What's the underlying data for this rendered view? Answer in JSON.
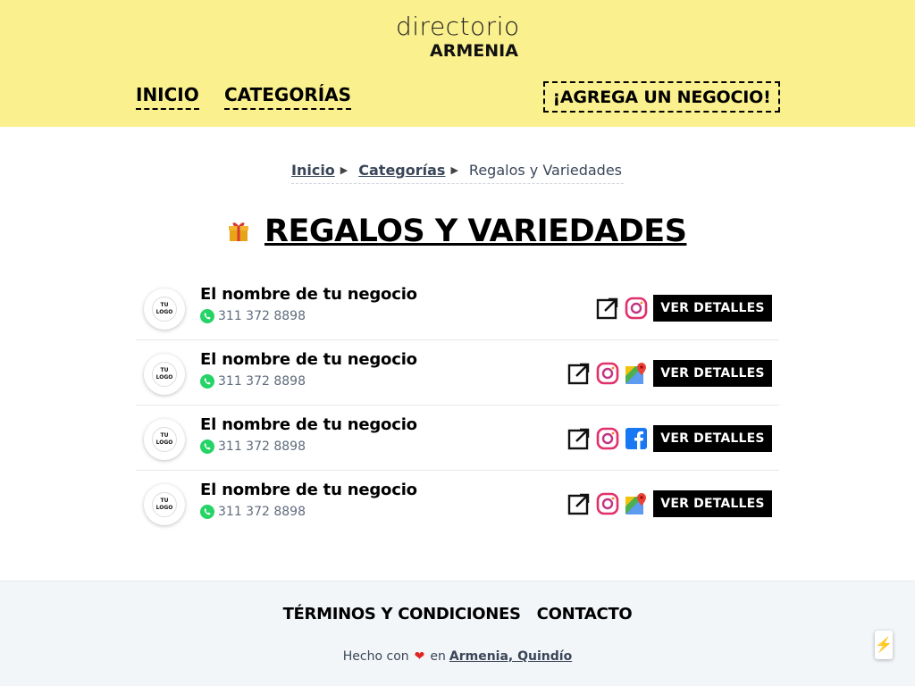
{
  "header": {
    "brand_top": "directorio",
    "brand_bottom": "ARMENIA",
    "nav": {
      "inicio": "INICIO",
      "categorias": "CATEGORÍAS"
    },
    "cta": "¡AGREGA UN NEGOCIO!",
    "background": "#faf08e"
  },
  "breadcrumb": {
    "items": [
      {
        "label": "Inicio"
      },
      {
        "label": "Categorías"
      }
    ],
    "current": "Regalos y Variedades"
  },
  "page": {
    "title": "REGALOS Y VARIEDADES",
    "title_icon": "gift-icon"
  },
  "listings": [
    {
      "logo_text": "TU LOGO",
      "name": "El nombre de tu negocio",
      "phone": "311 372 8898",
      "icons": [
        "external-link-icon",
        "instagram-icon"
      ],
      "button": "VER DETALLES"
    },
    {
      "logo_text": "TU LOGO",
      "name": "El nombre de tu negocio",
      "phone": "311 372 8898",
      "icons": [
        "external-link-icon",
        "instagram-icon",
        "google-maps-icon"
      ],
      "button": "VER DETALLES"
    },
    {
      "logo_text": "TU LOGO",
      "name": "El nombre de tu negocio",
      "phone": "311 372 8898",
      "icons": [
        "external-link-icon",
        "instagram-icon",
        "facebook-icon"
      ],
      "button": "VER DETALLES"
    },
    {
      "logo_text": "TU LOGO",
      "name": "El nombre de tu negocio",
      "phone": "311 372 8898",
      "icons": [
        "external-link-icon",
        "instagram-icon",
        "google-maps-icon"
      ],
      "button": "VER DETALLES"
    }
  ],
  "footer": {
    "terms": "TÉRMINOS Y CONDICIONES",
    "contact": "CONTACTO",
    "made_prefix": "Hecho con",
    "made_mid": "en",
    "made_link": "Armenia, Quindío"
  },
  "floating": {
    "icon": "lightning-icon",
    "symbol": "⚡"
  },
  "colors": {
    "accent_yellow": "#faf08e",
    "button_black": "#000000",
    "whatsapp_green": "#25d366",
    "heart_red": "#e02424",
    "facebook_blue": "#1877f2"
  }
}
